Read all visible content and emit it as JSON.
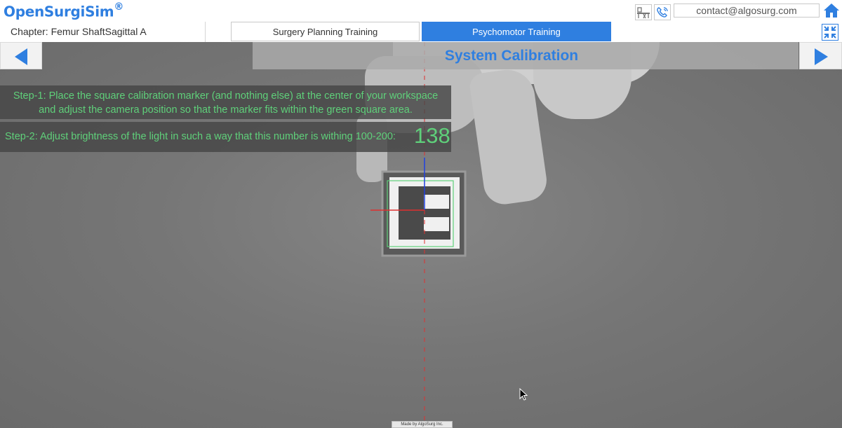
{
  "app": {
    "logo": "OpenSurgiSim",
    "logo_mark": "®"
  },
  "header": {
    "email": "contact@algosurg.com"
  },
  "chapter": {
    "label": "Chapter: Femur ShaftSagittal A"
  },
  "tabs": [
    {
      "label": "Surgery Planning Training",
      "active": false
    },
    {
      "label": "Psychomotor Training",
      "active": true
    }
  ],
  "page": {
    "title": "System Calibration"
  },
  "instructions": {
    "step1_line1": "Step-1: Place the square calibration marker (and nothing else) at the center of your workspace",
    "step1_line2": "and adjust the camera position so that the marker fits within the green square area.",
    "step2": "Step-2: Adjust brightness of the light in such a way that this number is withing 100-200:",
    "brightness_value": "138"
  },
  "footer": {
    "credit": "Made by AlgoSurg Inc."
  },
  "icons": {
    "header": [
      "desk-user-icon",
      "phone-icon",
      "home-icon"
    ],
    "nav": [
      "arrow-left-icon",
      "arrow-right-icon"
    ],
    "toolbar": [
      "fullscreen-exit-icon"
    ]
  },
  "colors": {
    "accent": "#2f7fe0",
    "instruction_text": "#5fd07a",
    "marker_outline": "#5fd07a",
    "crosshair_x": "#e03030",
    "crosshair_y": "#2040e0"
  }
}
